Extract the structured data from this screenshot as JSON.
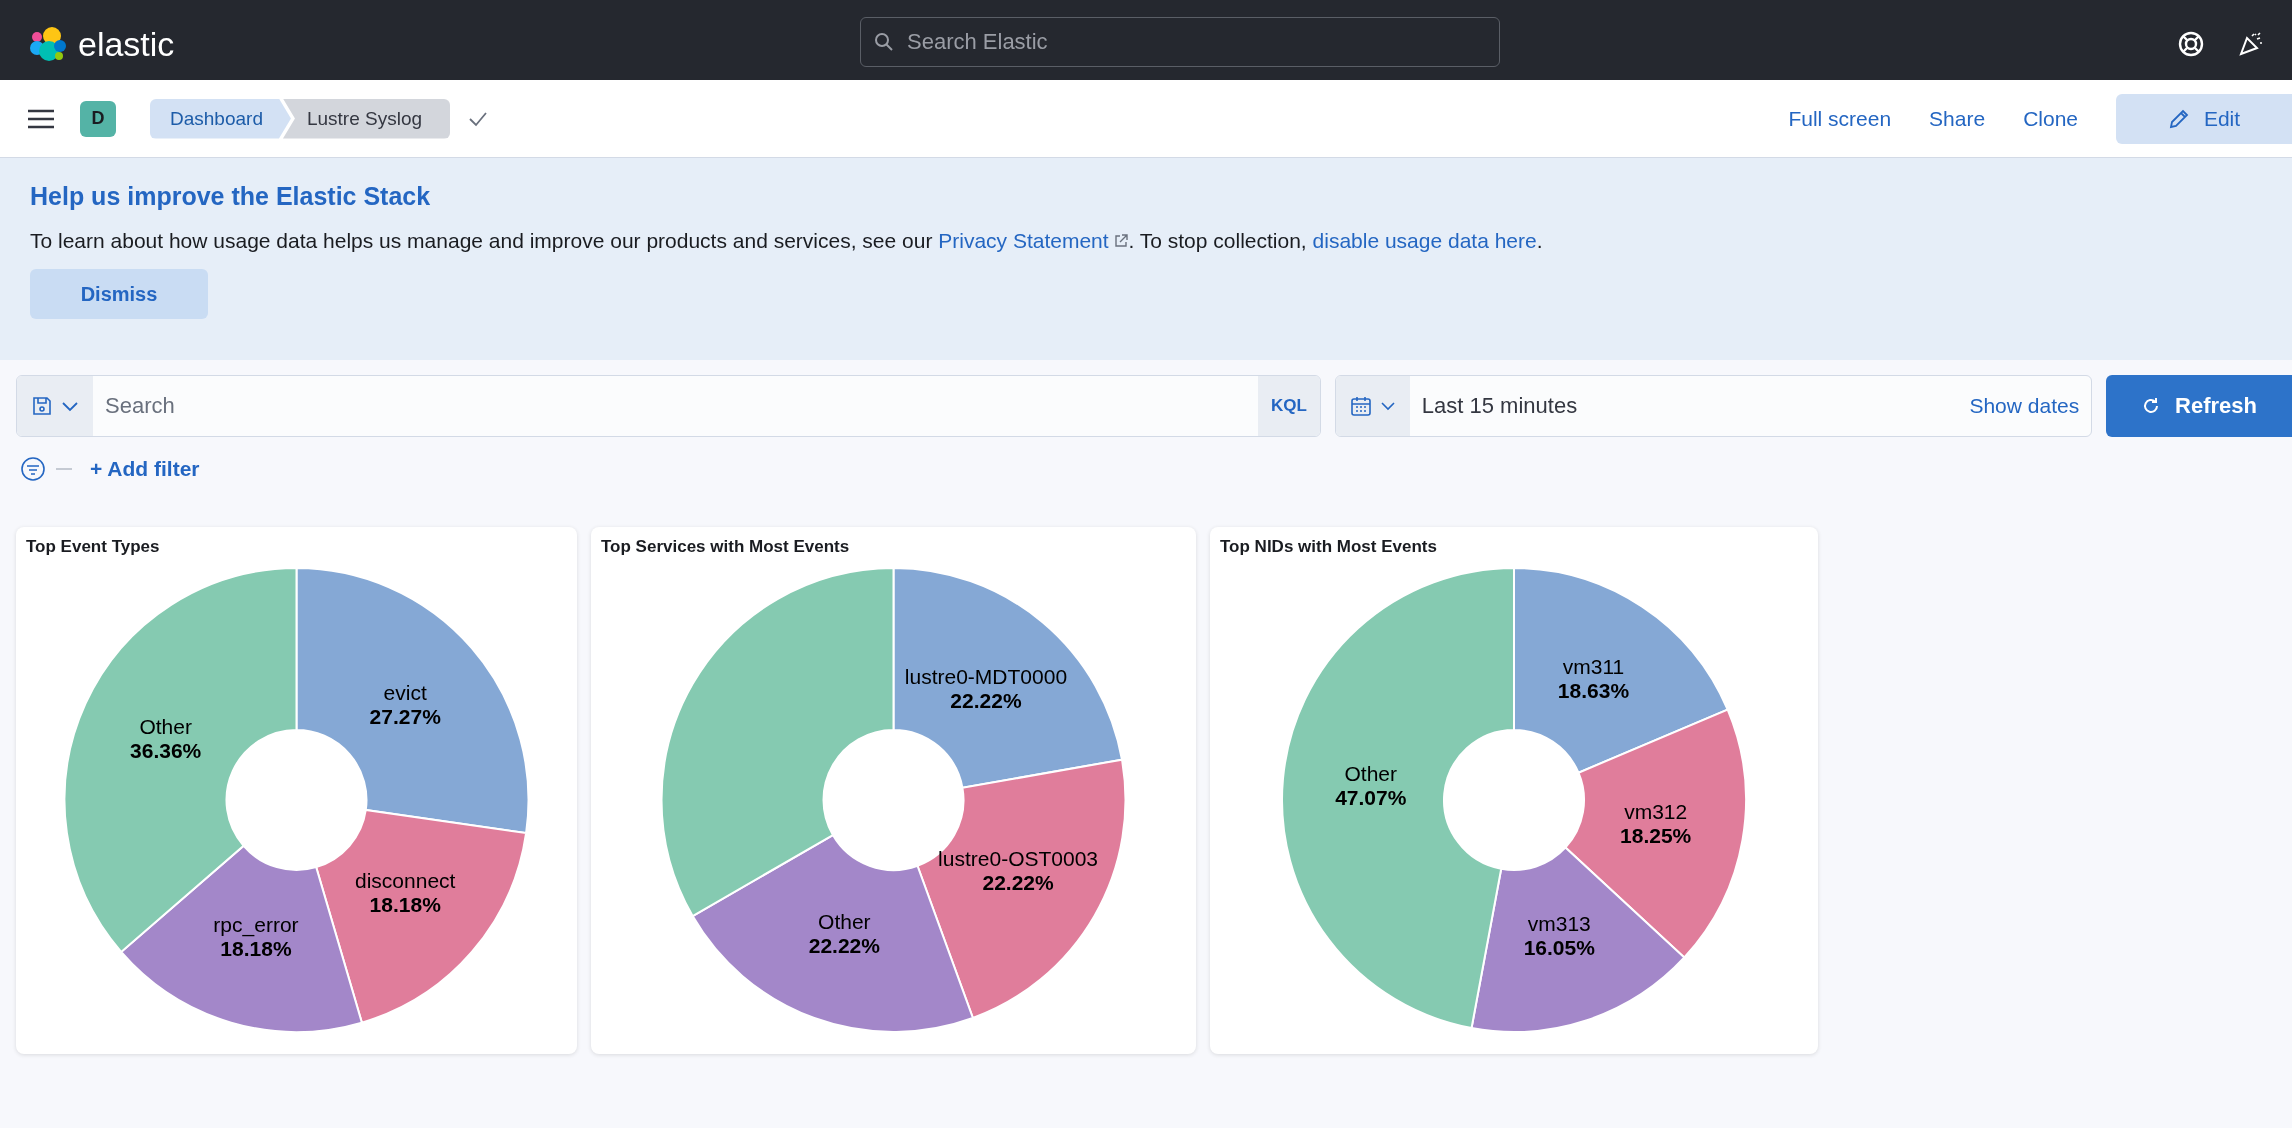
{
  "header": {
    "logo": "elastic",
    "search": {
      "placeholder": "Search Elastic"
    }
  },
  "nav": {
    "avatar": "D",
    "breadcrumbs": [
      {
        "label": "Dashboard",
        "selected": false
      },
      {
        "label": "Lustre Syslog",
        "selected": true
      }
    ],
    "actions": [
      "Full screen",
      "Share",
      "Clone"
    ],
    "edit_button": "Edit"
  },
  "banner": {
    "title": "Help us improve the Elastic Stack",
    "text_before": "To learn about how usage data helps us manage and improve our products and services, see our ",
    "privacy_link": "Privacy Statement",
    "text_middle": ". To stop collection, ",
    "disable_link": "disable usage data here",
    "text_after": ".",
    "dismiss": "Dismiss"
  },
  "query": {
    "placeholder": "Search",
    "language": "KQL",
    "time_range": "Last 15 minutes",
    "show_dates": "Show dates",
    "refresh": "Refresh"
  },
  "filters": {
    "add_filter": "+ Add filter"
  },
  "panels": [
    {
      "chart_data": {
        "type": "donut",
        "title": "Top Event Types",
        "categories": [
          "evict",
          "disconnect",
          "rpc_error",
          "Other"
        ],
        "values": [
          27.27,
          18.18,
          18.18,
          36.36
        ],
        "colors": [
          "#85a8d5",
          "#e07d9b",
          "#a387c9",
          "#85cab1"
        ],
        "value_labels": [
          "27.27%",
          "18.18%",
          "18.18%",
          "36.36%"
        ],
        "data_labels": true
      }
    },
    {
      "chart_data": {
        "type": "donut",
        "title": "Top Services with Most Events",
        "categories": [
          "lustre0-MDT0000",
          "lustre0-OST0003",
          "Other",
          null
        ],
        "values": [
          22.22,
          22.22,
          22.22,
          33.34
        ],
        "colors": [
          "#85a8d5",
          "#e07d9b",
          "#a387c9",
          "#85cab1"
        ],
        "value_labels": [
          "22.22%",
          "22.22%",
          "22.22%",
          null
        ],
        "data_labels": true
      }
    },
    {
      "chart_data": {
        "type": "donut",
        "title": "Top NIDs with Most Events",
        "categories": [
          "vm311",
          "vm312",
          "vm313",
          "Other"
        ],
        "values": [
          18.63,
          18.25,
          16.05,
          47.07
        ],
        "colors": [
          "#85a8d5",
          "#e07d9b",
          "#a387c9",
          "#85cab1"
        ],
        "value_labels": [
          "18.63%",
          "18.25%",
          "16.05%",
          "47.07%"
        ],
        "data_labels": true
      }
    }
  ]
}
